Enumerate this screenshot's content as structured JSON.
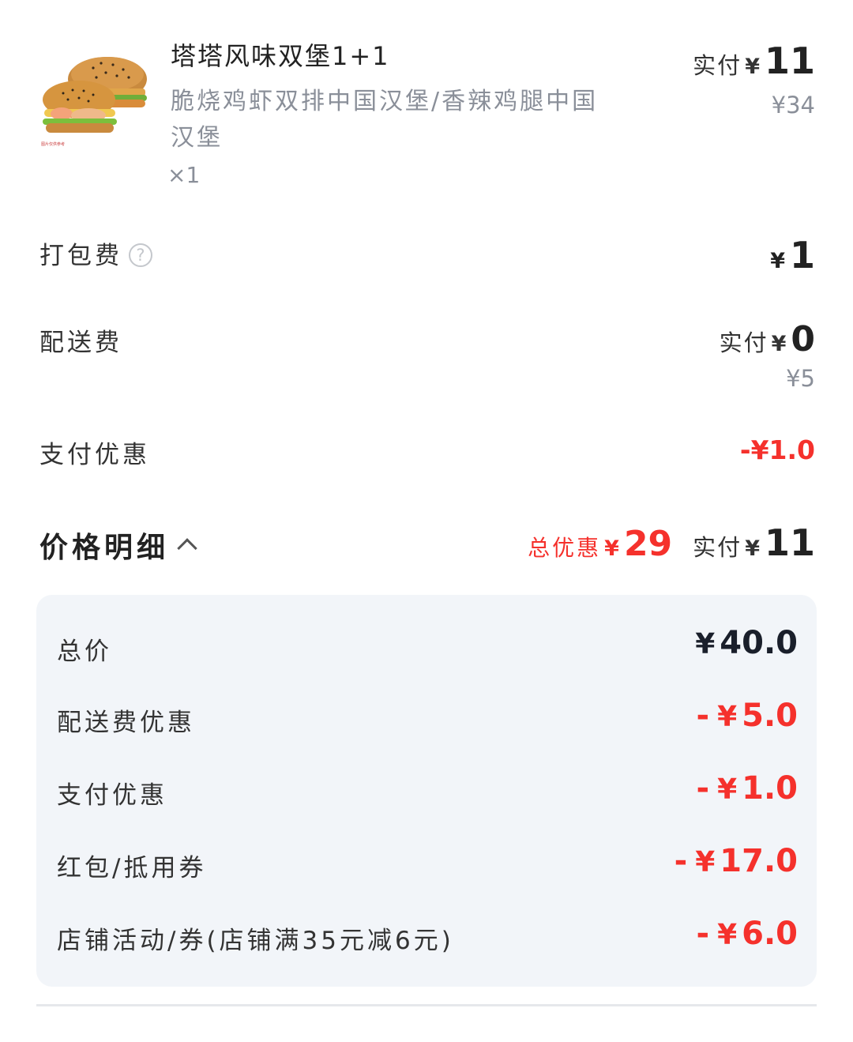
{
  "product": {
    "name": "塔塔风味双堡1+1",
    "description": "脆烧鸡虾双排中国汉堡/香辣鸡腿中国汉堡",
    "quantity": "×1",
    "paid_label": "实付",
    "currency": "¥",
    "paid_amount": "11",
    "original_price": "¥34"
  },
  "packing_fee": {
    "label": "打包费",
    "help_icon": "question-circle-icon",
    "currency": "¥",
    "amount": "1"
  },
  "delivery_fee": {
    "label": "配送费",
    "paid_label": "实付",
    "currency": "¥",
    "paid_amount": "0",
    "original_price": "¥5"
  },
  "payment_discount": {
    "label": "支付优惠",
    "value": "-¥1.0"
  },
  "price_detail": {
    "title": "价格明细",
    "chevron_icon": "chevron-up-icon",
    "total_discount_label": "总优惠",
    "currency": "¥",
    "total_discount": "29",
    "paid_label": "实付",
    "paid_amount": "11",
    "rows": [
      {
        "label": "总价",
        "sign": "",
        "currency": "¥",
        "amount": "40.0",
        "color": "#1a1f2b"
      },
      {
        "label": "配送费优惠",
        "sign": "-",
        "currency": "¥",
        "amount": "5.0",
        "color": "#f5312c"
      },
      {
        "label": "支付优惠",
        "sign": "-",
        "currency": "¥",
        "amount": "1.0",
        "color": "#f5312c"
      },
      {
        "label": "红包/抵用券",
        "sign": "-",
        "currency": "¥",
        "amount": "17.0",
        "color": "#f5312c"
      },
      {
        "label": "店铺活动/券(店铺满35元减6元)",
        "sign": "-",
        "currency": "¥",
        "amount": "6.0",
        "color": "#f5312c"
      }
    ]
  },
  "colors": {
    "accent_red": "#f5312c",
    "muted_text": "#8a8f99",
    "detail_bg": "#f2f5f9"
  }
}
